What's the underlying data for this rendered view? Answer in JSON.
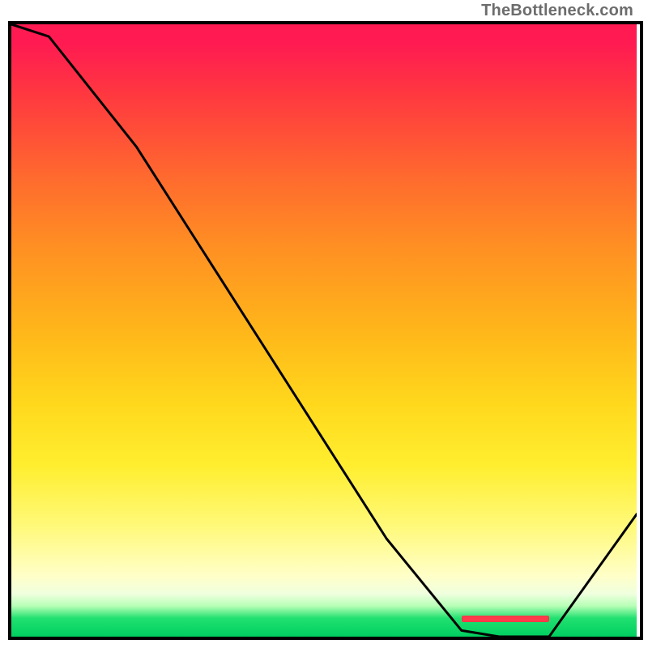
{
  "attribution": "TheBottleneck.com",
  "colors": {
    "frame": "#000000",
    "curve": "#000000",
    "marker": "#ff3a4a",
    "gradient_top": "#ff1a52",
    "gradient_bottom": "#00d060"
  },
  "chart_data": {
    "type": "line",
    "title": "",
    "xlabel": "",
    "ylabel": "",
    "xlim": [
      0,
      100
    ],
    "ylim": [
      0,
      100
    ],
    "x": [
      0,
      6,
      20,
      40,
      60,
      72,
      78,
      82,
      86,
      100
    ],
    "y": [
      100,
      98,
      80,
      48,
      16,
      1,
      0,
      0,
      0,
      20
    ],
    "optimal_band_x": [
      72,
      86
    ],
    "gradient_meaning": "bottleneck severity (red = high, green = none)"
  }
}
